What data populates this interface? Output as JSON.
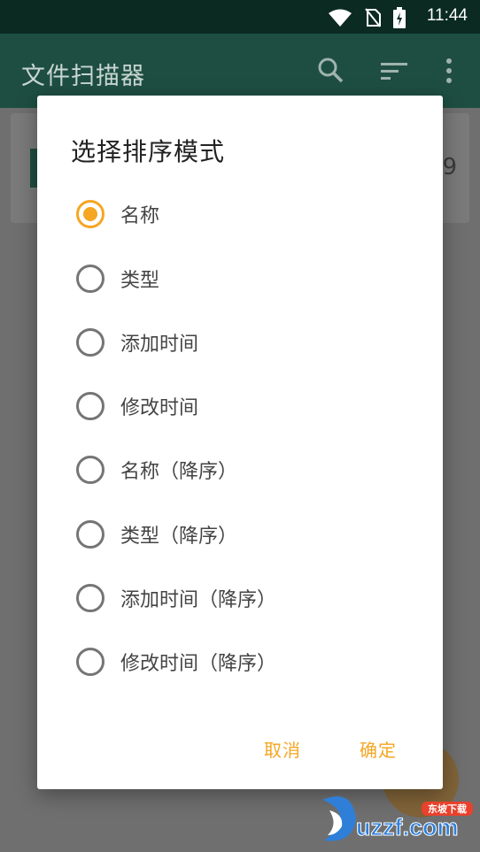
{
  "status_bar": {
    "time": "11:44"
  },
  "app_bar": {
    "title": "文件扫描器"
  },
  "background": {
    "card_number": "9"
  },
  "dialog": {
    "title": "选择排序模式",
    "options": [
      {
        "label": "名称",
        "checked": true
      },
      {
        "label": "类型",
        "checked": false
      },
      {
        "label": "添加时间",
        "checked": false
      },
      {
        "label": "修改时间",
        "checked": false
      },
      {
        "label": "名称（降序）",
        "checked": false
      },
      {
        "label": "类型（降序）",
        "checked": false
      },
      {
        "label": "添加时间（降序）",
        "checked": false
      },
      {
        "label": "修改时间（降序）",
        "checked": false
      }
    ],
    "cancel_label": "取消",
    "confirm_label": "确定"
  },
  "watermark": {
    "text": "uzzf.com",
    "badge": "东坡下载"
  },
  "colors": {
    "accent": "#f5a623",
    "app_bar": "#1e4e42",
    "status_bar": "#0a2a22"
  },
  "icons": [
    "wifi-icon",
    "no-sim-icon",
    "battery-icon",
    "search-icon",
    "sort-icon",
    "more-vert-icon"
  ]
}
